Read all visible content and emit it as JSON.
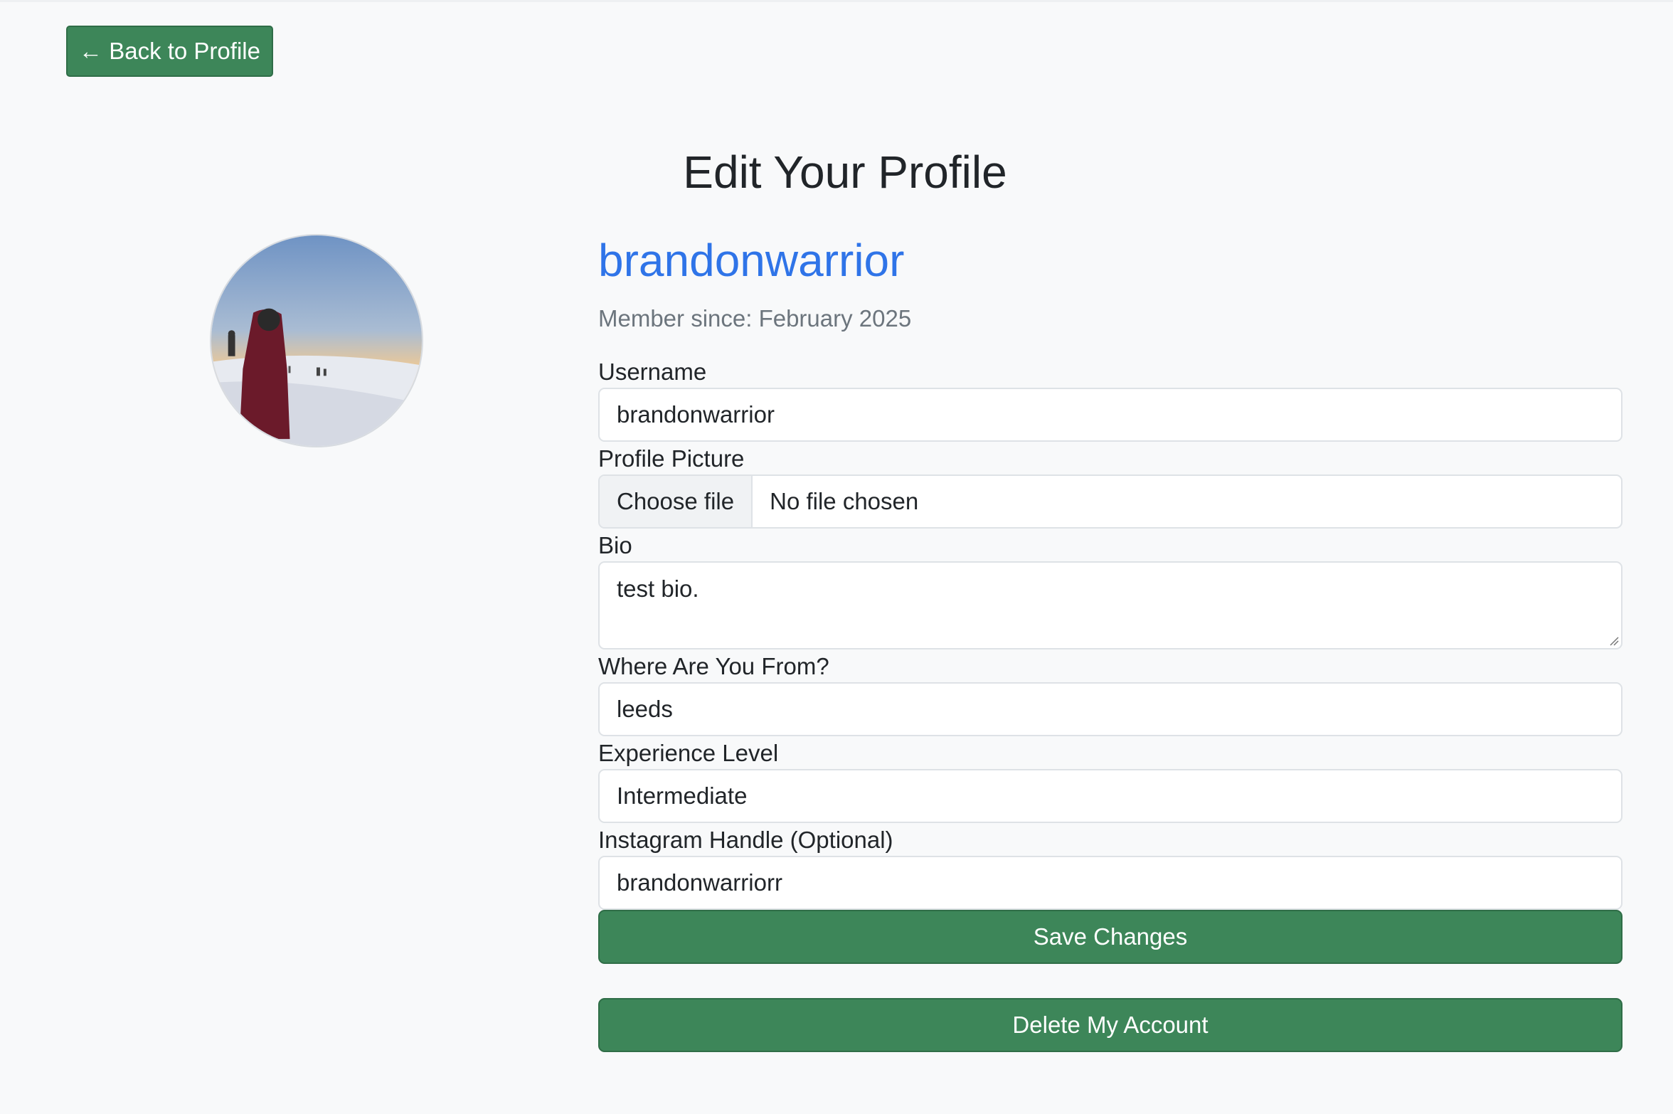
{
  "nav": {
    "back_label": "← Back to Profile"
  },
  "page": {
    "title": "Edit Your Profile"
  },
  "profile": {
    "username_display": "brandonwarrior",
    "member_since": "Member since: February 2025"
  },
  "form": {
    "username": {
      "label": "Username",
      "value": "brandonwarrior"
    },
    "profile_picture": {
      "label": "Profile Picture",
      "button_label": "Choose file",
      "status": "No file chosen"
    },
    "bio": {
      "label": "Bio",
      "value": "test bio."
    },
    "location": {
      "label": "Where Are You From?",
      "value": "leeds"
    },
    "experience": {
      "label": "Experience Level",
      "value": "Intermediate"
    },
    "instagram": {
      "label": "Instagram Handle (Optional)",
      "value": "brandonwarriorr"
    },
    "save_label": "Save Changes",
    "delete_label": "Delete My Account"
  },
  "colors": {
    "accent_green": "#3d8659",
    "username_blue": "#2f74e8",
    "background": "#f8f9fa"
  },
  "icons": {
    "back": "left-arrow-icon",
    "resize": "resize-grip-icon"
  }
}
